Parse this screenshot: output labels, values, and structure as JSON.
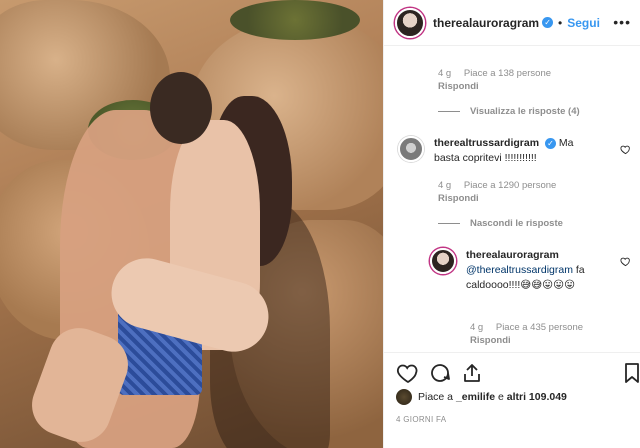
{
  "post": {
    "username": "therealauroragram",
    "follow_label": "Segui",
    "dot": "•",
    "more": "•••"
  },
  "comments": {
    "c0": {
      "time": "4 g",
      "likes": "Piace a 138 persone",
      "reply": "Rispondi"
    },
    "view_replies": "Visualizza le risposte (4)",
    "c1": {
      "username": "therealtrussardigram",
      "text": "Ma basta copritevi !!!!!!!!!!!",
      "time": "4 g",
      "likes": "Piace a 1290 persone",
      "reply": "Rispondi"
    },
    "hide_replies": "Nascondi le risposte",
    "c2": {
      "username": "therealauroragram",
      "mention": "@therealtrussardigram",
      "text": "fa caldoooo!!!!😅😅😛😛😛",
      "time": "4 g",
      "likes": "Piace a 435 persone",
      "reply": "Rispondi"
    }
  },
  "actions": {
    "liked_prefix": "Piace a ",
    "liked_user": "_emilife",
    "liked_mid": " e ",
    "liked_others": "altri 109.049",
    "date": "4 GIORNI FA"
  },
  "colors": {
    "accent": "#3897f0",
    "muted": "#8e8e8e",
    "text": "#262626"
  }
}
